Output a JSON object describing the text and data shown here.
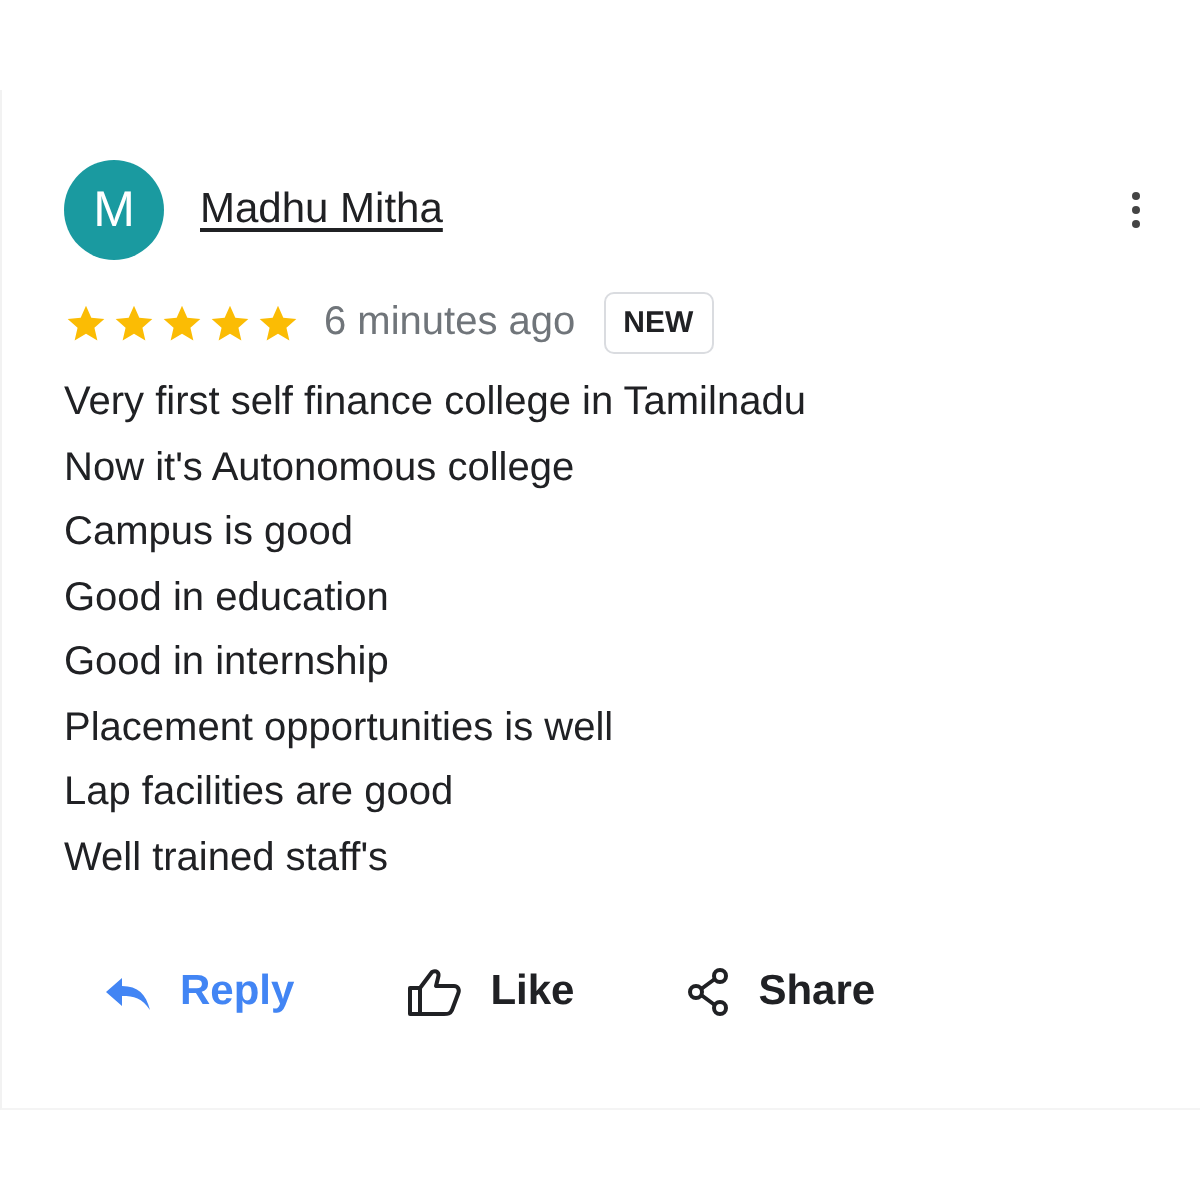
{
  "review": {
    "avatar_letter": "M",
    "author": "Madhu Mitha",
    "stars": 5,
    "time": "6 minutes ago",
    "badge": "NEW",
    "lines": [
      "Very first self finance college in Tamilnadu",
      "Now it's Autonomous college",
      "Campus is good",
      "Good in education",
      "Good in internship",
      "Placement opportunities is well",
      "Lap facilities are good",
      "Well trained staff's"
    ],
    "actions": [
      {
        "kind": "reply",
        "label": "Reply"
      },
      {
        "kind": "like",
        "label": "Like"
      },
      {
        "kind": "share",
        "label": "Share"
      }
    ]
  }
}
